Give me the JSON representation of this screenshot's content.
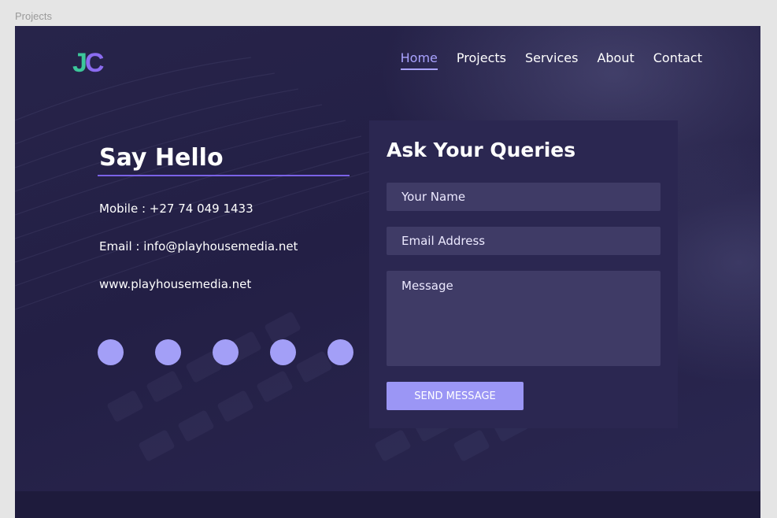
{
  "frame": {
    "label": "Projects"
  },
  "logo": {
    "letter_j": "J",
    "letter_c": "C"
  },
  "nav": {
    "items": [
      {
        "label": "Home",
        "active": true
      },
      {
        "label": "Projects",
        "active": false
      },
      {
        "label": "Services",
        "active": false
      },
      {
        "label": "About",
        "active": false
      },
      {
        "label": "Contact",
        "active": false
      }
    ]
  },
  "contact": {
    "heading": "Say Hello",
    "mobile": "Mobile : +27 74 049 1433",
    "email": "Email : info@playhousemedia.net",
    "website": "www.playhousemedia.net"
  },
  "social": {
    "count": 5
  },
  "form": {
    "title": "Ask Your Queries",
    "name_placeholder": "Your Name",
    "email_placeholder": "Email Address",
    "message_placeholder": "Message",
    "submit_label": "SEND MESSAGE"
  },
  "colors": {
    "accent": "#a9a3ff",
    "button": "#9b96f5",
    "logo_green": "#3cc79a",
    "logo_purple": "#8b6cf0",
    "background": "#1c1938"
  }
}
